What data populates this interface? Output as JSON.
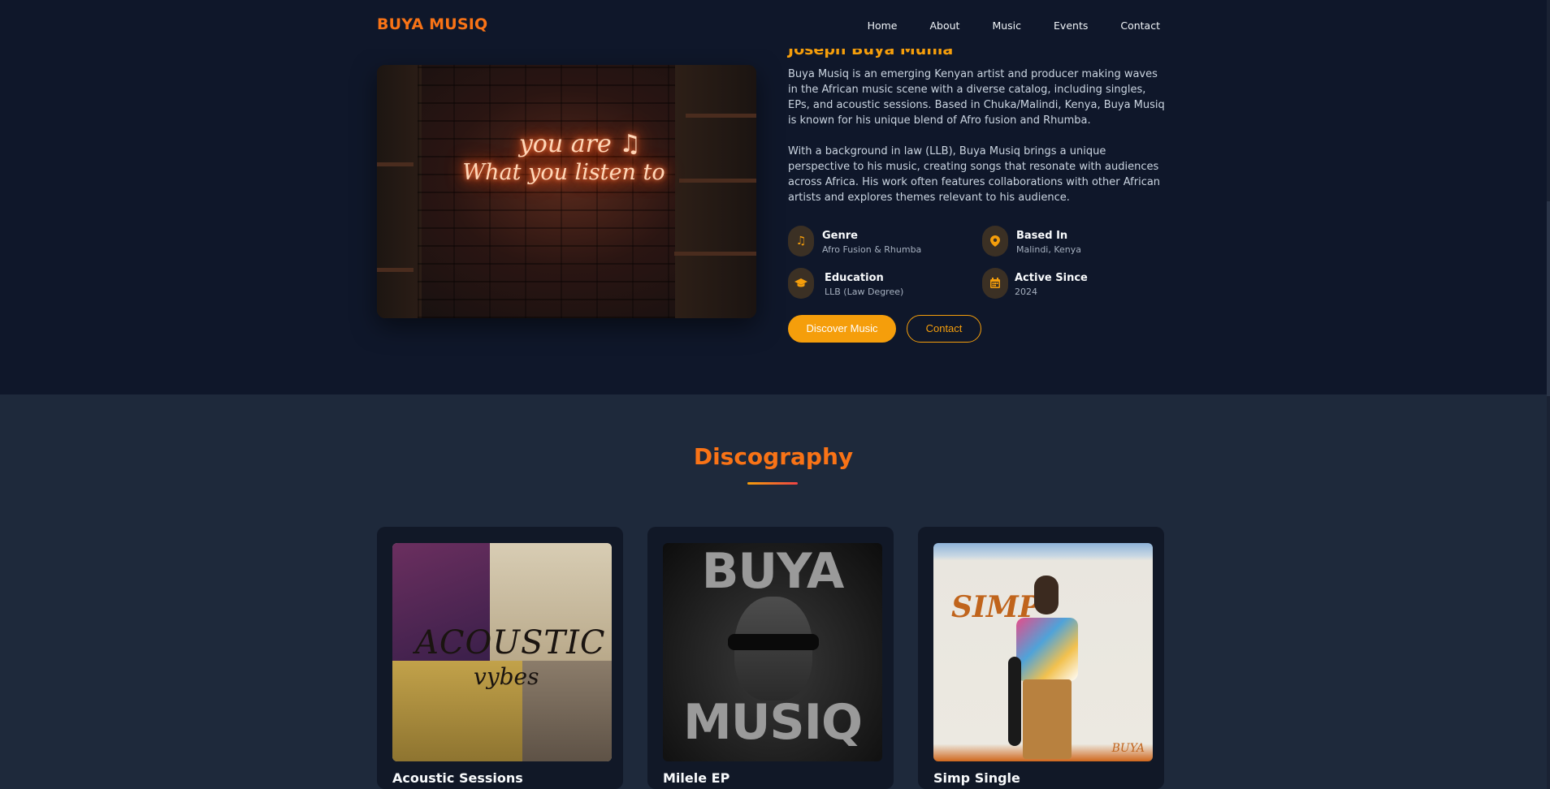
{
  "header": {
    "logo": "BUYA MUSIQ",
    "nav": [
      "Home",
      "About",
      "Music",
      "Events",
      "Contact"
    ]
  },
  "about": {
    "name": "Joseph Buya Muhia",
    "hero_image_text": [
      "you are ♫",
      "What you listen to"
    ],
    "paragraphs": [
      "Buya Musiq is an emerging Kenyan artist and producer making waves in the African music scene with a diverse catalog, including singles, EPs, and acoustic sessions. Based in Chuka/Malindi, Kenya, Buya Musiq is known for his unique blend of Afro fusion and Rhumba.",
      "With a background in law (LLB), Buya Musiq brings a unique perspective to his music, creating songs that resonate with audiences across Africa. His work often features collaborations with other African artists and explores themes relevant to his audience."
    ],
    "facts": [
      {
        "icon": "music-note-icon",
        "label": "Genre",
        "value": "Afro Fusion & Rhumba"
      },
      {
        "icon": "location-pin-icon",
        "label": "Based In",
        "value": "Malindi, Kenya"
      },
      {
        "icon": "graduation-cap-icon",
        "label": "Education",
        "value": "LLB (Law Degree)"
      },
      {
        "icon": "calendar-icon",
        "label": "Active Since",
        "value": "2024"
      }
    ],
    "buttons": {
      "primary": "Discover Music",
      "secondary": "Contact"
    }
  },
  "discography": {
    "title": "Discography",
    "albums": [
      {
        "title": "Acoustic Sessions",
        "cover_text": [
          "ACOUSTIC",
          "vybes"
        ]
      },
      {
        "title": "Milele EP",
        "cover_text": [
          "BUYA",
          "MUSIQ"
        ]
      },
      {
        "title": "Simp Single",
        "cover_text": [
          "SIMP",
          "BUYA"
        ]
      }
    ]
  },
  "colors": {
    "background": "#0f172a",
    "section_alt": "#1e293b",
    "accent": "#f59e0b",
    "brand": "#f97316"
  }
}
